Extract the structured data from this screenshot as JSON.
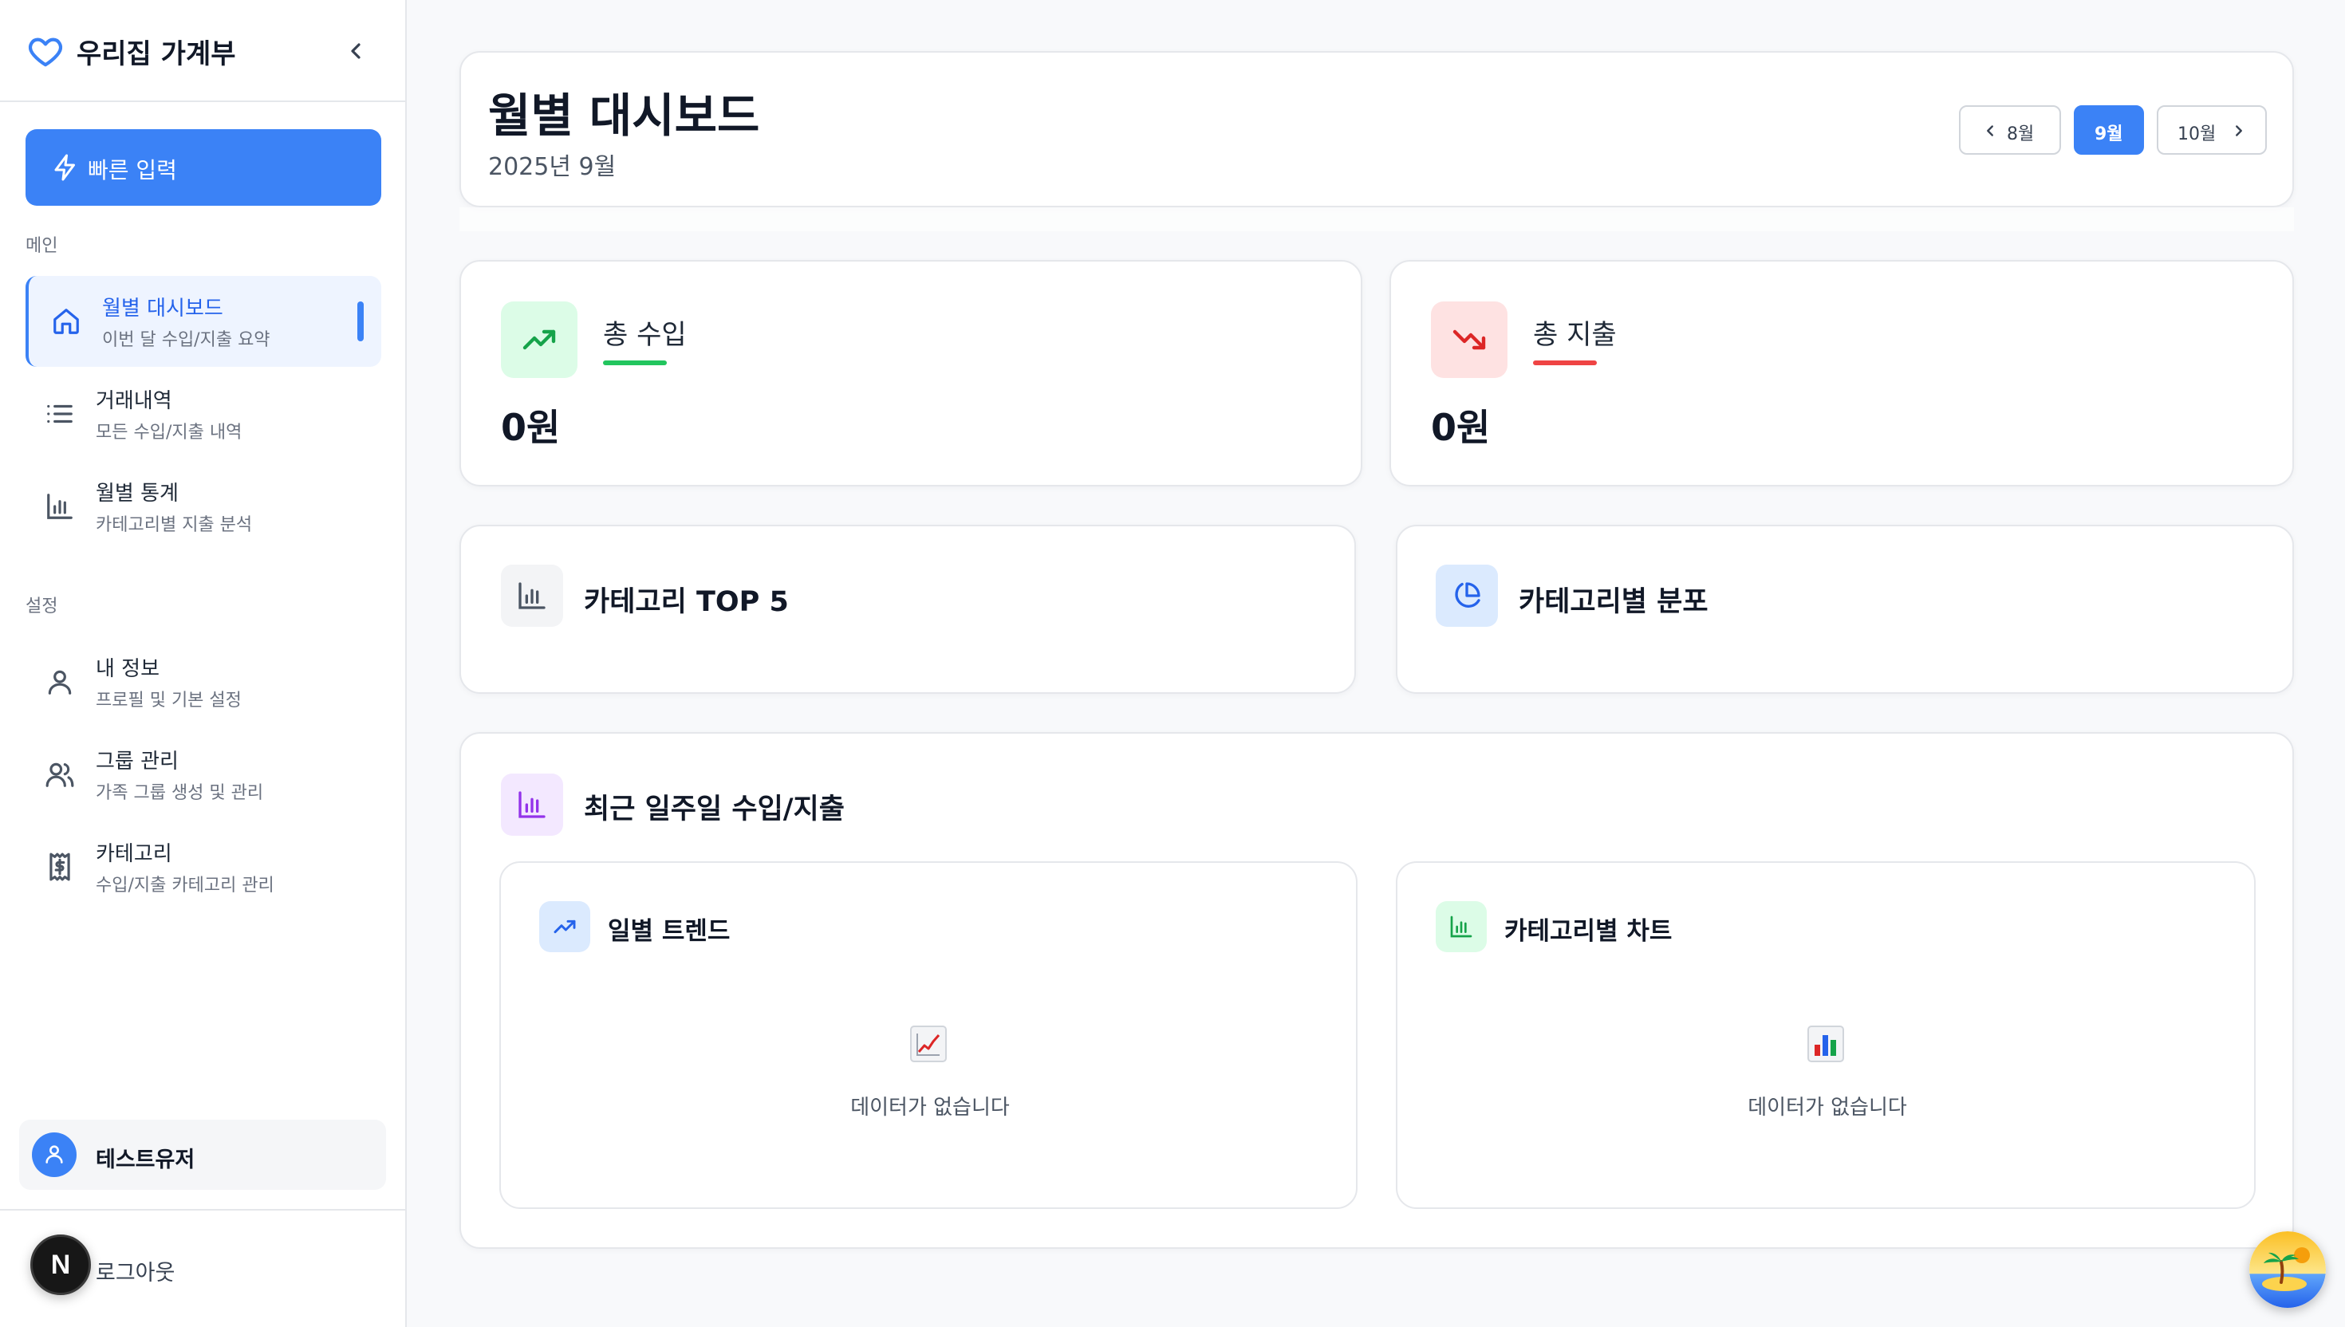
{
  "app": {
    "title": "우리집 가계부"
  },
  "sidebar": {
    "quick_input": "빠른 입력",
    "sections": {
      "main": "메인",
      "settings": "설정"
    },
    "main_items": [
      {
        "title": "월별 대시보드",
        "subtitle": "이번 달 수입/지출 요약",
        "icon": "home-icon",
        "active": true
      },
      {
        "title": "거래내역",
        "subtitle": "모든 수입/지출 내역",
        "icon": "list-icon"
      },
      {
        "title": "월별 통계",
        "subtitle": "카테고리별 지출 분석",
        "icon": "bar-chart-icon"
      }
    ],
    "settings_items": [
      {
        "title": "내 정보",
        "subtitle": "프로필 및 기본 설정",
        "icon": "user-icon"
      },
      {
        "title": "그룹 관리",
        "subtitle": "가족 그룹 생성 및 관리",
        "icon": "users-icon"
      },
      {
        "title": "카테고리",
        "subtitle": "수입/지출 카테고리 관리",
        "icon": "receipt-dollar-icon"
      }
    ],
    "user_name": "테스트유저",
    "logout": "로그아웃",
    "badge_letter": "N"
  },
  "header": {
    "title": "월별 대시보드",
    "subtitle": "2025년 9월",
    "prev_month": "8월",
    "current_month": "9월",
    "next_month": "10월"
  },
  "stats": {
    "income": {
      "label": "총 수입",
      "value": "0원",
      "color": "#22c55e"
    },
    "expense": {
      "label": "총 지출",
      "value": "0원",
      "color": "#ef4444"
    }
  },
  "category_top": {
    "title": "카테고리 TOP 5"
  },
  "category_dist": {
    "title": "카테고리별 분포"
  },
  "weekly": {
    "title": "최근 일주일 수입/지출",
    "daily_trend": {
      "title": "일별 트렌드",
      "empty": "데이터가 없습니다",
      "glyph": "📈"
    },
    "category_chart": {
      "title": "카테고리별 차트",
      "empty": "데이터가 없습니다",
      "glyph": "📊"
    }
  },
  "colors": {
    "accent": "#3b82f6",
    "income": "#22c55e",
    "expense": "#ef4444",
    "purple": "#a855f7"
  }
}
